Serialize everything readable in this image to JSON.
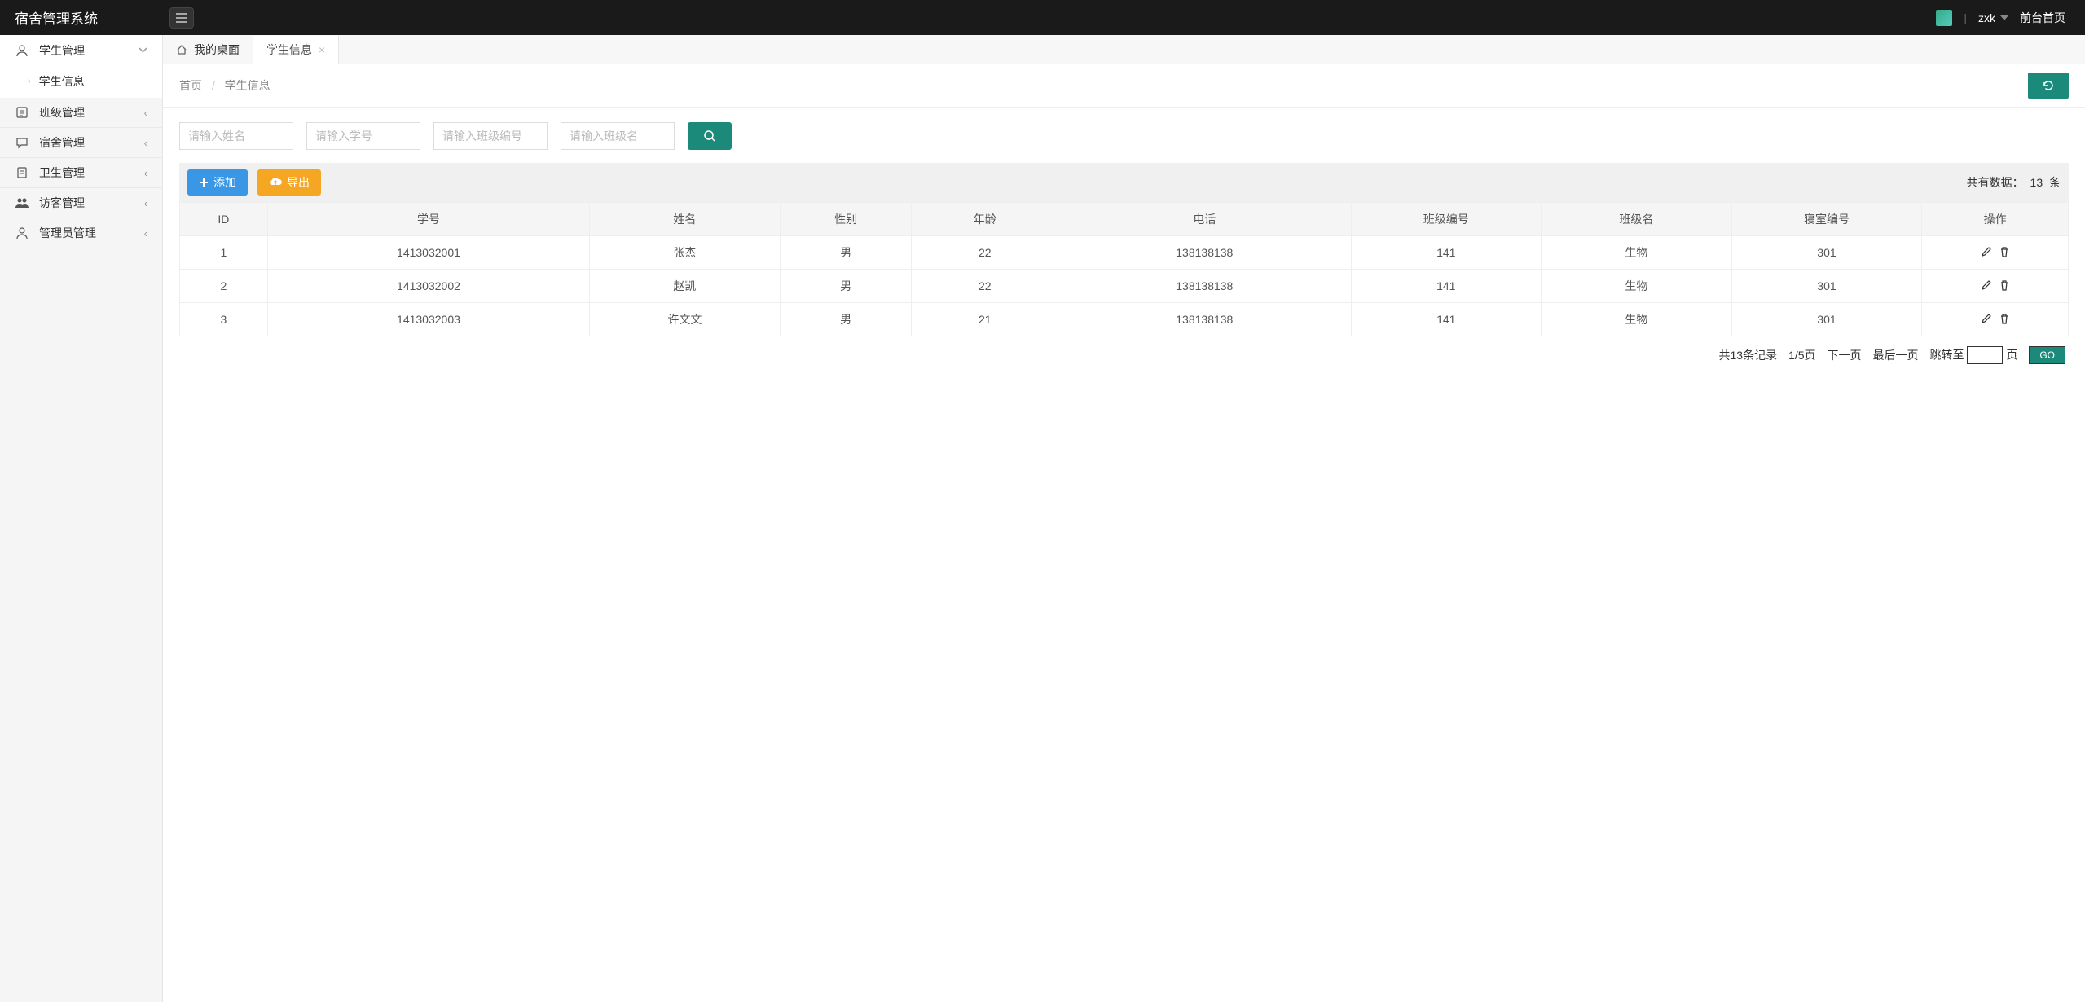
{
  "header": {
    "app_title": "宿舍管理系统",
    "username": "zxk",
    "frontend_link": "前台首页"
  },
  "sidebar": {
    "items": [
      {
        "label": "学生管理",
        "icon": "user",
        "expanded": true,
        "children": [
          {
            "label": "学生信息"
          }
        ]
      },
      {
        "label": "班级管理",
        "icon": "list"
      },
      {
        "label": "宿舍管理",
        "icon": "chat"
      },
      {
        "label": "卫生管理",
        "icon": "doc"
      },
      {
        "label": "访客管理",
        "icon": "users"
      },
      {
        "label": "管理员管理",
        "icon": "user"
      }
    ]
  },
  "tabs": {
    "desktop": "我的桌面",
    "active": "学生信息"
  },
  "breadcrumb": {
    "home": "首页",
    "current": "学生信息"
  },
  "search": {
    "name_placeholder": "请输入姓名",
    "sno_placeholder": "请输入学号",
    "classno_placeholder": "请输入班级编号",
    "classname_placeholder": "请输入班级名"
  },
  "toolbar": {
    "add_label": "添加",
    "export_label": "导出",
    "count_prefix": "共有数据：",
    "count_value": "13",
    "count_suffix": " 条"
  },
  "table": {
    "headers": [
      "ID",
      "学号",
      "姓名",
      "性别",
      "年龄",
      "电话",
      "班级编号",
      "班级名",
      "寝室编号",
      "操作"
    ],
    "rows": [
      {
        "id": "1",
        "sno": "1413032001",
        "name": "张杰",
        "gender": "男",
        "age": "22",
        "phone": "138138138",
        "classno": "141",
        "classname": "生物",
        "dorm": "301"
      },
      {
        "id": "2",
        "sno": "1413032002",
        "name": "赵凯",
        "gender": "男",
        "age": "22",
        "phone": "138138138",
        "classno": "141",
        "classname": "生物",
        "dorm": "301"
      },
      {
        "id": "3",
        "sno": "1413032003",
        "name": "许文文",
        "gender": "男",
        "age": "21",
        "phone": "138138138",
        "classno": "141",
        "classname": "生物",
        "dorm": "301"
      }
    ]
  },
  "pagination": {
    "total_text": "共13条记录",
    "page_text": "1/5页",
    "next": "下一页",
    "last": "最后一页",
    "jump_prefix": "跳转至",
    "jump_suffix": "页",
    "go": "GO"
  }
}
